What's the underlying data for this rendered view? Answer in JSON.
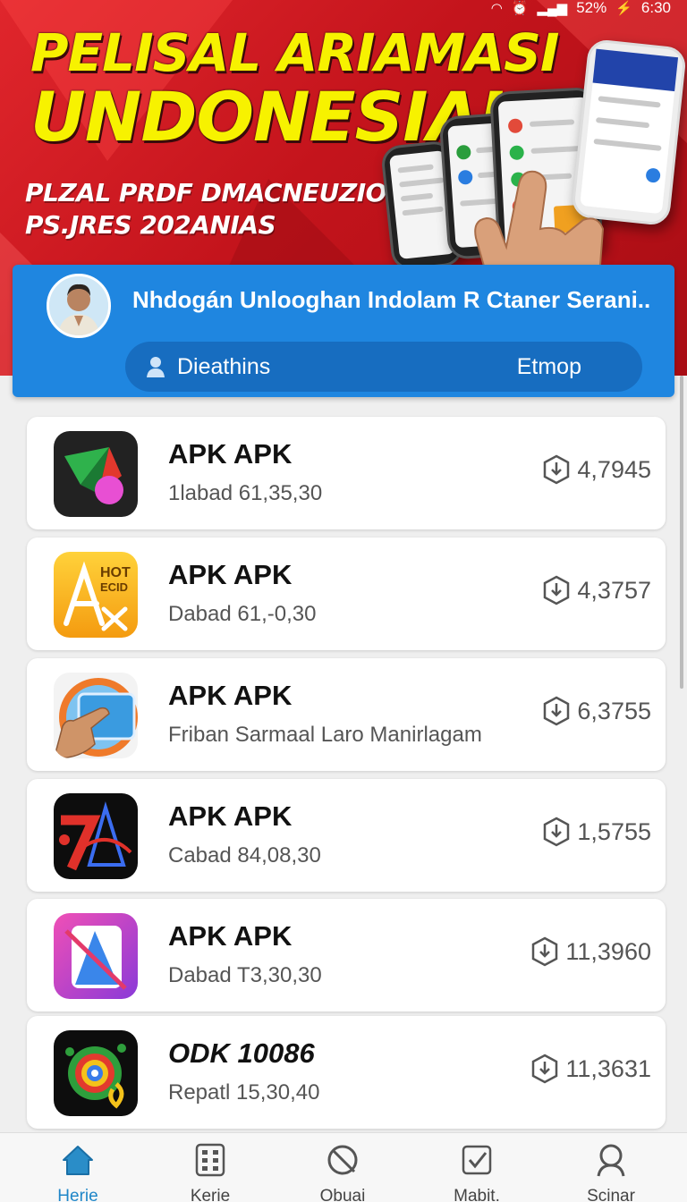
{
  "status_bar": {
    "battery": "52%",
    "time": "6:30"
  },
  "hero": {
    "title_line1": "PELISAL ARIAMASI",
    "title_line2": "UNDONESIAI",
    "subtitle_line1": "PLZAL PRDF DMACNEUZION",
    "subtitle_line2": "PS.JRES 202ANIAS"
  },
  "profile": {
    "name": "Nhdogán Unlooghan Indolam R Ctaner Serani..",
    "search_label": "Dieathins",
    "search_action": "Etmop"
  },
  "apps": [
    {
      "title": "APK APK",
      "subtitle": "1labad 61,35,30",
      "downloads": "4,7945",
      "icon": "green-paper-plane-icon"
    },
    {
      "title": "APK APK",
      "subtitle": "Dabad 61,-0,30",
      "downloads": "4,3757",
      "icon": "hot-ecid-icon"
    },
    {
      "title": "APK APK",
      "subtitle": "Friban Sarmaal Laro Manirlagam",
      "downloads": "6,3755",
      "icon": "hand-tablet-icon"
    },
    {
      "title": "APK APK",
      "subtitle": "Cabad 84,08,30",
      "downloads": "1,5755",
      "icon": "red-7a-icon"
    },
    {
      "title": "APK APK",
      "subtitle": "Dabad T3,30,30",
      "downloads": "11,3960",
      "icon": "purple-tablet-icon"
    },
    {
      "title": "ODK 10086",
      "subtitle": "Repatl 15,30,40",
      "downloads": "11,3631",
      "icon": "colorful-gear-icon"
    }
  ],
  "nav": [
    {
      "label": "Herie",
      "icon": "home-icon",
      "active": true
    },
    {
      "label": "Kerie",
      "icon": "calculator-icon",
      "active": false
    },
    {
      "label": "Obuai",
      "icon": "block-icon",
      "active": false
    },
    {
      "label": "Mabit.",
      "icon": "checkbox-icon",
      "active": false
    },
    {
      "label": "Scinar",
      "icon": "search-icon",
      "active": false
    }
  ],
  "colors": {
    "banner_red": "#d41a22",
    "title_yellow": "#f7f200",
    "profile_blue": "#1f86e0",
    "nav_active": "#1f86c8"
  }
}
